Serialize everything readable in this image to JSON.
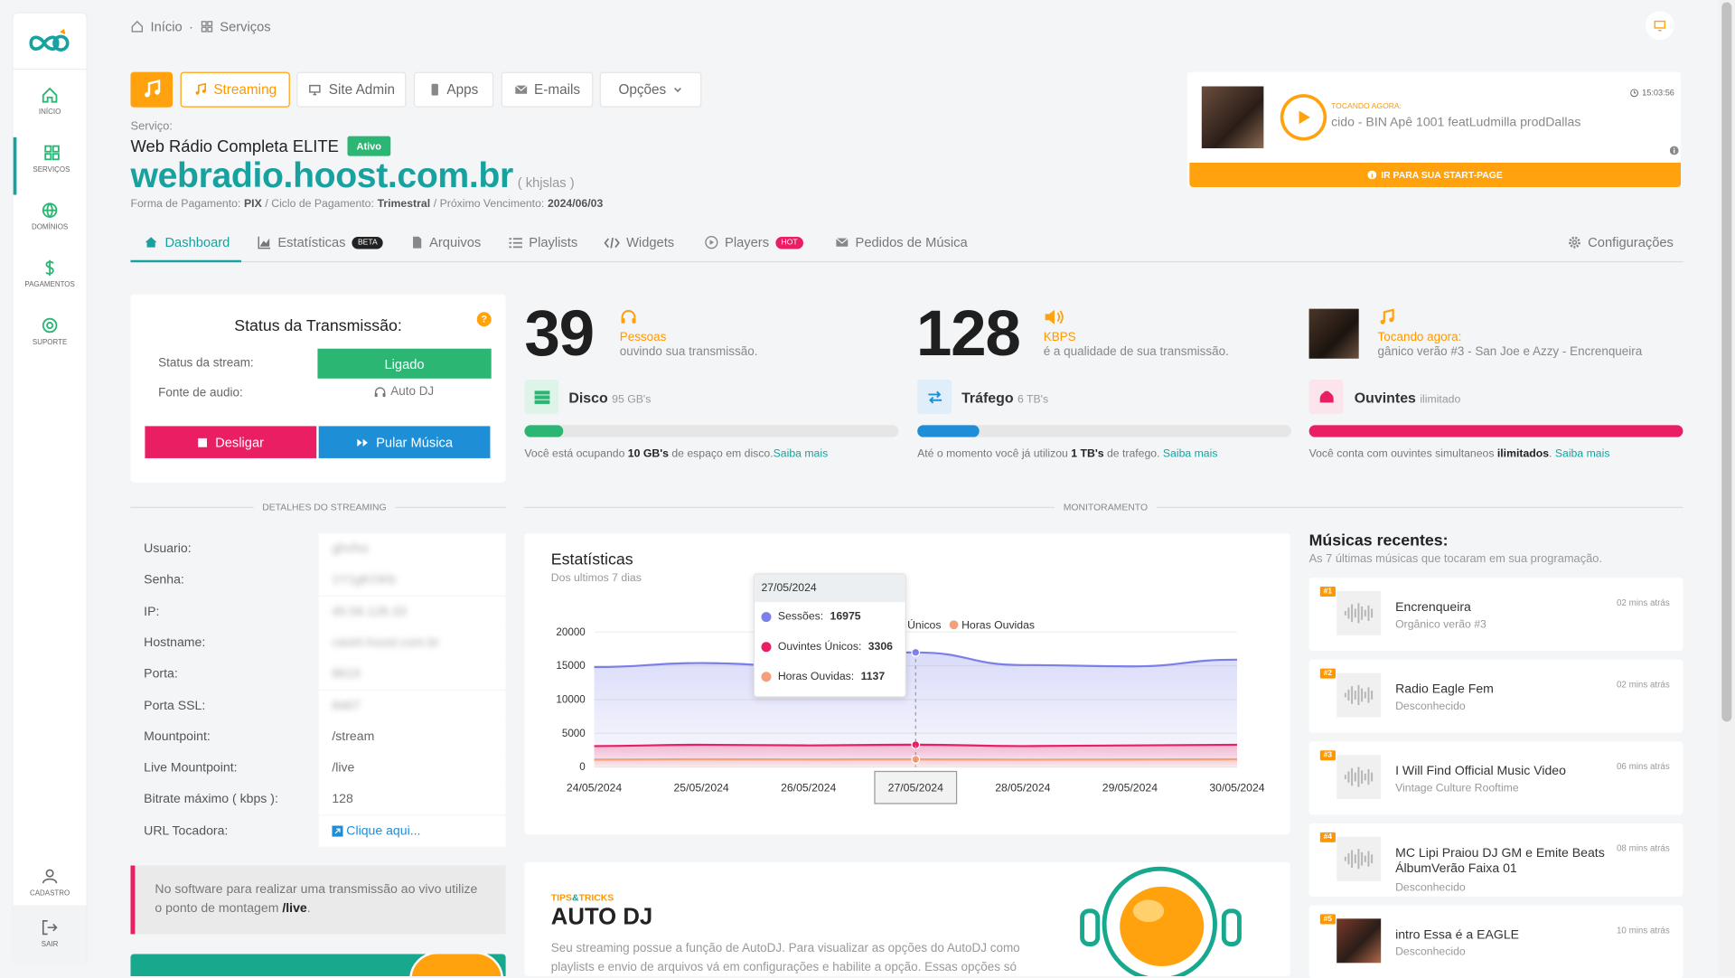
{
  "sidebar": {
    "items": [
      {
        "label": "INÍCIO",
        "icon": "home-icon"
      },
      {
        "label": "SERVIÇOS",
        "icon": "grid-icon"
      },
      {
        "label": "DOMÍNIOS",
        "icon": "globe-icon"
      },
      {
        "label": "PAGAMENTOS",
        "icon": "dollar-icon"
      },
      {
        "label": "SUPORTE",
        "icon": "lifebuoy-icon"
      }
    ],
    "bottom": [
      {
        "label": "CADASTRO",
        "icon": "user-icon"
      },
      {
        "label": "SAIR",
        "icon": "logout-icon"
      }
    ]
  },
  "breadcrumb": {
    "home": "Início",
    "sep": "·",
    "current": "Serviços"
  },
  "toolbar": {
    "streaming": "Streaming",
    "site_admin": "Site Admin",
    "apps": "Apps",
    "emails": "E-mails",
    "opcoes": "Opções"
  },
  "service": {
    "label": "Serviço:",
    "name": "Web Rádio Completa ELITE",
    "status": "Ativo",
    "domain": "webradio.hoost.com.br",
    "alias": "( khjslas )",
    "payment_label": "Forma de Pagamento:",
    "payment": "PIX",
    "cycle_label": "/ Ciclo de Pagamento:",
    "cycle": "Trimestral",
    "due_label": "/ Próximo Vencimento:",
    "due": "2024/06/03"
  },
  "player": {
    "time": "15:03:56",
    "now_label": "TOCANDO AGORA:",
    "track": "cido - BIN Apê 1001 featLudmilla prodDallas",
    "startpage": "IR PARA SUA START-PAGE"
  },
  "tabs": [
    {
      "label": "Dashboard",
      "icon": "home-icon"
    },
    {
      "label": "Estatísticas",
      "icon": "chart-icon",
      "pill": "BETA"
    },
    {
      "label": "Arquivos",
      "icon": "file-icon"
    },
    {
      "label": "Playlists",
      "icon": "list-icon"
    },
    {
      "label": "Widgets",
      "icon": "code-icon"
    },
    {
      "label": "Players",
      "icon": "play-icon",
      "pill": "HOT"
    },
    {
      "label": "Pedidos de Música",
      "icon": "mail-icon"
    },
    {
      "label": "Configurações",
      "icon": "gear-icon"
    }
  ],
  "status": {
    "title": "Status da Transmissão:",
    "stream_label": "Status da stream:",
    "stream_value": "Ligado",
    "source_label": "Fonte de audio:",
    "source_value": "Auto DJ",
    "off_button": "Desligar",
    "skip_button": "Pular Música"
  },
  "stats": {
    "listeners_count": "39",
    "listeners_label": "Pessoas",
    "listeners_sub": "ouvindo sua transmissão.",
    "bitrate": "128",
    "bitrate_label": "KBPS",
    "bitrate_sub": "é a qualidade de sua transmissão.",
    "now_label": "Tocando agora:",
    "now_track": "gânico verão #3 - San Joe e Azzy - Encrenqueira"
  },
  "resources": {
    "disk": {
      "title": "Disco",
      "cap": "95 GB's",
      "note_pre": "Você está ocupando",
      "note_val": "10 GB's",
      "note_post": "de espaço em disco.",
      "link": "Saiba mais",
      "fill": 0.105,
      "color": "#2bb673"
    },
    "traffic": {
      "title": "Tráfego",
      "cap": "6 TB's",
      "note_pre": "Até o momento você já utilizou",
      "note_val": "1 TB's",
      "note_post": "de trafego.",
      "link": "Saiba mais",
      "fill": 0.167,
      "color": "#1e8fd6"
    },
    "listeners": {
      "title": "Ouvintes",
      "cap": "ilimitado",
      "note_pre": "Você conta com ouvintes simultaneos",
      "note_val": "ilimitados",
      "note_post": ".",
      "link": "Saiba mais",
      "fill": 1,
      "color": "#e91e63"
    }
  },
  "dividers": {
    "details": "DETALHES DO STREAMING",
    "monitor": "MONITORAMENTO"
  },
  "details": [
    {
      "k": "Usuario:",
      "v": "ghvfxs",
      "blur": true
    },
    {
      "k": "Senha:",
      "v": "1Y1gKOKb",
      "blur": true
    },
    {
      "k": "IP:",
      "v": "45.56.126.33",
      "blur": true
    },
    {
      "k": "Hostname:",
      "v": "cast4.hoost.com.br",
      "blur": true
    },
    {
      "k": "Porta:",
      "v": "8619",
      "blur": true
    },
    {
      "k": "Porta SSL:",
      "v": "8467",
      "blur": true
    },
    {
      "k": "Mountpoint:",
      "v": "/stream",
      "blur": false
    },
    {
      "k": "Live Mountpoint:",
      "v": "/live",
      "blur": false
    },
    {
      "k": "Bitrate máximo ( kbps ):",
      "v": "128",
      "blur": false
    },
    {
      "k": "URL Tocadora:",
      "v": "Clique aqui...",
      "blur": false,
      "link": true
    }
  ],
  "live_note": {
    "text": "No software para realizar uma transmissão ao vivo utilize o ponto de montagem",
    "mount": "/live",
    "end": "."
  },
  "chart_card": {
    "title": "Estatísticas",
    "subtitle": "Dos ultimos 7 dias"
  },
  "chart_data": {
    "type": "area",
    "x": [
      "24/05/2024",
      "25/05/2024",
      "26/05/2024",
      "27/05/2024",
      "28/05/2024",
      "29/05/2024",
      "30/05/2024"
    ],
    "ylim": [
      0,
      20000
    ],
    "yticks": [
      "0",
      "5000",
      "10000",
      "15000",
      "20000"
    ],
    "series": [
      {
        "name": "Sessões",
        "color": "#7b7fe8",
        "values": [
          14800,
          15400,
          14900,
          16975,
          15100,
          14900,
          15900
        ]
      },
      {
        "name": "Ouvintes Únicos",
        "color": "#e91e63",
        "values": [
          3100,
          3300,
          3200,
          3306,
          3100,
          3200,
          3300
        ]
      },
      {
        "name": "Horas Ouvidas",
        "color": "#f4a07a",
        "values": [
          1100,
          1150,
          1120,
          1137,
          1090,
          1120,
          1150
        ]
      }
    ],
    "legend_visible": [
      "Únicos",
      "Horas Ouvidas"
    ],
    "tooltip": {
      "date": "27/05/2024",
      "rows": [
        {
          "label": "Sessões:",
          "value": "16975",
          "color": "#7b7fe8"
        },
        {
          "label": "Ouvintes Únicos:",
          "value": "3306",
          "color": "#e91e63"
        },
        {
          "label": "Horas Ouvidas:",
          "value": "1137",
          "color": "#f4a07a"
        }
      ]
    },
    "highlight_label": "27/05/2024"
  },
  "tips": {
    "eyebrow_a": "TIPS",
    "eyebrow_b": "&",
    "eyebrow_c": "TRICKS",
    "title": "AUTO DJ",
    "text": "Seu streaming possue a função de AutoDJ. Para visualizar as opções do AutoDJ como playlists e envio de arquivos vá em configurações e habilite a opção. Essas opções só"
  },
  "recent": {
    "title": "Músicas recentes:",
    "subtitle": "As 7 últimas músicas que tocaram em sua programação.",
    "items": [
      {
        "n": "#1",
        "title": "Encrenqueira",
        "artist": "Orgânico verão #3",
        "time": "02 mins atrás"
      },
      {
        "n": "#2",
        "title": "Radio Eagle Fem",
        "artist": "Desconhecido",
        "time": "02 mins atrás"
      },
      {
        "n": "#3",
        "title": "I Will Find Official Music Video",
        "artist": "Vintage Culture Rooftime",
        "time": "06 mins atrás"
      },
      {
        "n": "#4",
        "title": "MC Lipi Praiou DJ GM e Emite Beats ÁlbumVerão Faixa 01",
        "artist": "Desconhecido",
        "time": "08 mins atrás"
      },
      {
        "n": "#5",
        "title": "intro Essa é a EAGLE",
        "artist": "Desconhecido",
        "time": "10 mins atrás"
      }
    ]
  }
}
